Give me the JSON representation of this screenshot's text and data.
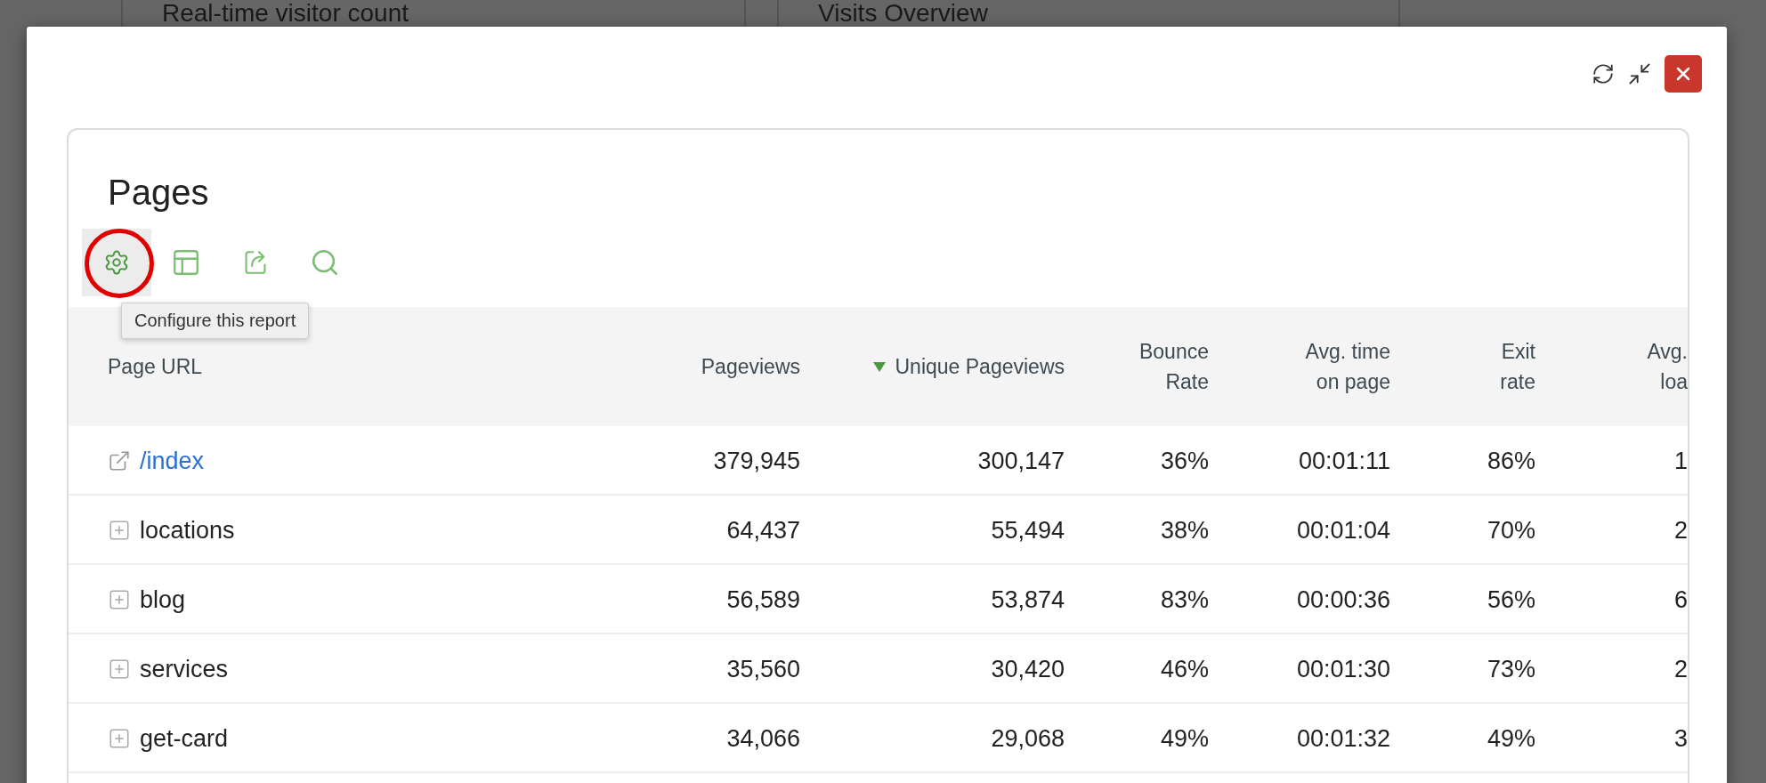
{
  "background_widgets": [
    {
      "title": "Real-time visitor count"
    },
    {
      "title": "Visits Overview"
    }
  ],
  "report": {
    "title": "Pages",
    "toolbar": [
      {
        "kind": "settings",
        "highlighted": true,
        "tooltip": "Configure this report"
      },
      {
        "kind": "table",
        "highlighted": false
      },
      {
        "kind": "export",
        "highlighted": false
      },
      {
        "kind": "search",
        "highlighted": false
      }
    ],
    "columns": [
      {
        "lines": [
          "Page URL"
        ],
        "sorted": false
      },
      {
        "lines": [
          "Pageviews"
        ],
        "sorted": false
      },
      {
        "lines": [
          "Unique Pageviews"
        ],
        "sorted": true
      },
      {
        "lines": [
          "Bounce",
          "Rate"
        ],
        "sorted": false
      },
      {
        "lines": [
          "Avg. time",
          "on page"
        ],
        "sorted": false
      },
      {
        "lines": [
          "Exit",
          "rate"
        ],
        "sorted": false
      },
      {
        "lines": [
          "Avg.",
          "loa"
        ],
        "sorted": false
      }
    ],
    "rows": [
      {
        "kind": "link",
        "cells": [
          "/index",
          "379,945",
          "300,147",
          "36%",
          "00:01:11",
          "86%",
          "1"
        ]
      },
      {
        "kind": "folder",
        "cells": [
          "locations",
          "64,437",
          "55,494",
          "38%",
          "00:01:04",
          "70%",
          "2"
        ]
      },
      {
        "kind": "folder",
        "cells": [
          "blog",
          "56,589",
          "53,874",
          "83%",
          "00:00:36",
          "56%",
          "6"
        ]
      },
      {
        "kind": "folder",
        "cells": [
          "services",
          "35,560",
          "30,420",
          "46%",
          "00:01:30",
          "73%",
          "2"
        ]
      },
      {
        "kind": "folder",
        "cells": [
          "get-card",
          "34,066",
          "29,068",
          "49%",
          "00:01:32",
          "49%",
          "3"
        ]
      }
    ]
  }
}
